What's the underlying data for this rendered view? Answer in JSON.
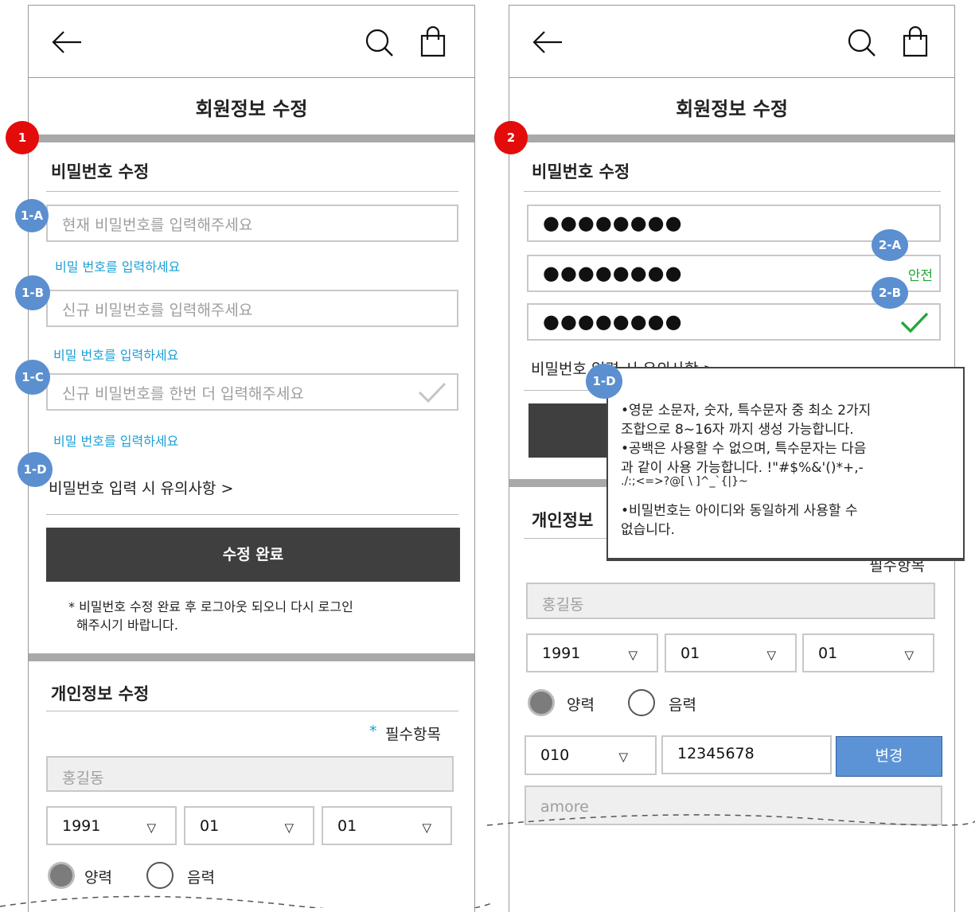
{
  "screen_1": {
    "title": "회원정보 수정",
    "marker": "1",
    "password_section": {
      "title": "비밀번호 수정",
      "current_pw_placeholder": "현재 비밀번호를 입력해주세요",
      "current_pw_hint": "비밀 번호를 입력하세요",
      "new_pw_placeholder": "신규 비밀번호를 입력해주세요",
      "new_pw_hint": "비밀 번호를 입력하세요",
      "confirm_pw_placeholder": "신규 비밀번호를 한번 더 입력해주세요",
      "confirm_pw_hint": "비밀 번호를 입력하세요",
      "notice_link": "비밀번호 입력 시 유의사항 >",
      "submit_label": "수정 완료",
      "logout_note_line1": "* 비밀번호 수정 완료 후 로그아웃 되오니 다시 로그인",
      "logout_note_line2": "해주시기 바랍니다.",
      "badges": [
        "1-A",
        "1-B",
        "1-C",
        "1-D"
      ]
    },
    "personal_section": {
      "title": "개인정보 수정",
      "required_mark": "*",
      "required_label": "필수항목",
      "name": "홍길동",
      "birth_year": "1991",
      "birth_month": "01",
      "birth_day": "01",
      "solar": "양력",
      "lunar": "음력"
    }
  },
  "screen_2": {
    "title": "회원정보 수정",
    "marker": "2",
    "password_section": {
      "title": "비밀번호 수정",
      "pw_dots": "●●●●●●●●",
      "strength_label": "안전",
      "notice_link": "비밀번호 입력 시 유의사항 >",
      "badges": [
        "2-A",
        "2-B",
        "1-D"
      ]
    },
    "tooltip": {
      "line1": "•영문 소문자, 숫자, 특수문자 중 최소 2가지",
      "line2": "조합으로 8~16자 까지 생성 가능합니다.",
      "line3": "•공백은 사용할 수 없으며, 특수문자는 다음",
      "line4": "과 같이 사용 가능합니다.  !\"#$%&'()*+,-",
      "line5": "./:;<=>?@[ \\ ]^_`{|}~",
      "line6": "•비밀번호는 아이디와 동일하게 사용할 수",
      "line7": "없습니다."
    },
    "personal_section": {
      "title_partial": "개인정보",
      "required_partial": "필수항목",
      "name": "홍길동",
      "birth_year": "1991",
      "birth_month": "01",
      "birth_day": "01",
      "solar": "양력",
      "lunar": "음력",
      "phone_prefix": "010",
      "phone_number": "12345678",
      "change_label": "변경",
      "email_id": "amore"
    }
  },
  "colors": {
    "hint_blue": "#1a9fd6",
    "badge_blue": "#5b8fd0",
    "marker_red": "#e40b0b",
    "button_dark": "#3f3f3f",
    "button_blue": "#5b93d6",
    "strength_green": "#22a83a"
  },
  "icons": [
    "back-arrow-icon",
    "search-icon",
    "shopping-bag-icon",
    "checkmark-icon",
    "dropdown-triangle-icon"
  ]
}
